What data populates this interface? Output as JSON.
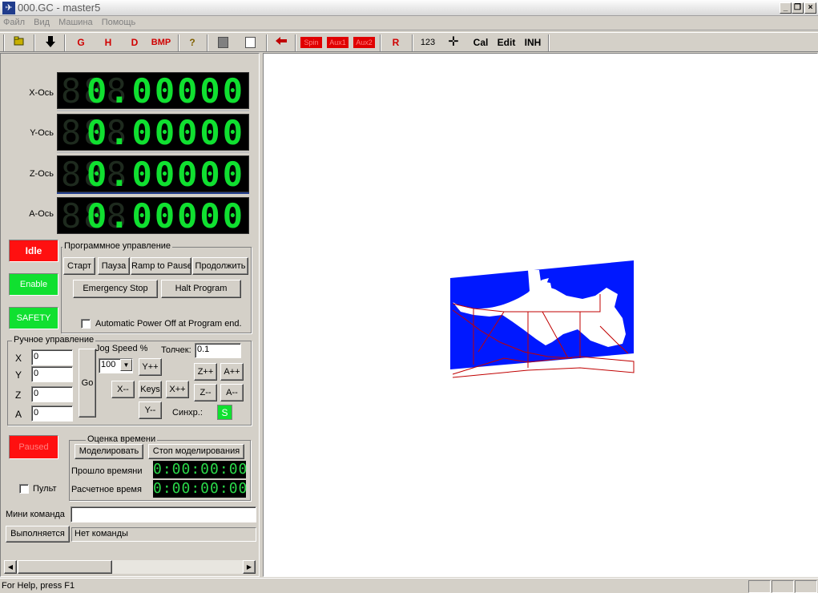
{
  "window": {
    "title": "000.GC - master5",
    "minimize": "_",
    "restore": "❐",
    "close": "×",
    "icon": "app-icon"
  },
  "menu": [
    "Файл",
    "Вид",
    "Машина",
    "Помощь"
  ],
  "toolbar": {
    "g": "G",
    "h": "H",
    "d": "D",
    "bmp": "BMP",
    "help": "?",
    "spin": "Spin",
    "aux1": "Aux1",
    "aux2": "Aux2",
    "r": "R",
    "numbers": "123",
    "cal": "Cal",
    "edit": "Edit",
    "inh": "INH",
    "accent_red": "#d00000"
  },
  "dro": {
    "ghost": "888",
    "axes": [
      {
        "label": "X-Ось",
        "value": "0.00000"
      },
      {
        "label": "Y-Ось",
        "value": "0.00000"
      },
      {
        "label": "Z-Ось",
        "value": "0.00000"
      },
      {
        "label": "A-Ось",
        "value": "0.00000"
      }
    ],
    "digit_color": "#10e030"
  },
  "status": {
    "idle": "Idle",
    "enable": "Enable",
    "safety": "SAFETY",
    "paused": "Paused",
    "red": "#ff1010",
    "green": "#10e030"
  },
  "program": {
    "title": "Программное управление",
    "start": "Старт",
    "pause": "Пауза",
    "ramp": "Ramp to Pause",
    "resume": "Продолжить",
    "estop": "Emergency Stop",
    "halt": "Halt Program",
    "auto_power": "Automatic Power Off at Program end."
  },
  "manual": {
    "title": "Ручное управление",
    "fields": [
      {
        "label": "X",
        "value": "0"
      },
      {
        "label": "Y",
        "value": "0"
      },
      {
        "label": "Z",
        "value": "0"
      },
      {
        "label": "A",
        "value": "0"
      }
    ],
    "go": "Go",
    "jog_speed_label": "Jog Speed %",
    "jog_speed_value": "100",
    "step_label": "Толчек:",
    "step_value": "0.1",
    "y_plus": "Y++",
    "y_minus": "Y--",
    "x_minus": "X--",
    "x_plus": "X++",
    "keys": "Keys",
    "z_plus": "Z++",
    "a_plus": "A++",
    "z_minus": "Z--",
    "a_minus": "A--",
    "sync_label": "Синхр.:",
    "sync_button": "S"
  },
  "timing": {
    "title": "Оценка времени",
    "simulate": "Моделировать",
    "stop_sim": "Стоп моделирования",
    "elapsed_label": "Прошло времяни",
    "elapsed_value": "0:00:00:00",
    "estimated_label": "Расчетное время",
    "estimated_value": "0:00:00:00"
  },
  "pendant": "Пульт",
  "mini_command": {
    "label": "Мини команда",
    "value": ""
  },
  "execution": {
    "button": "Выполняется",
    "status": "Нет команды"
  },
  "statusbar": {
    "help": "For Help, press F1"
  }
}
